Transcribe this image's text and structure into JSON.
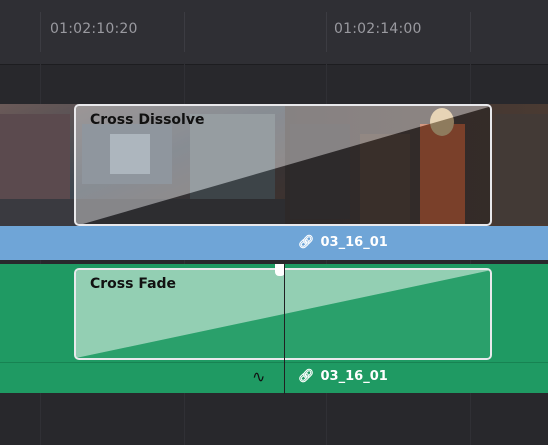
{
  "timeline": {
    "timecodes": [
      "01:02:10:20",
      "01:02:14:00"
    ]
  },
  "video_track": {
    "transition_label": "Cross Dissolve",
    "clip_name": "03_16_01",
    "link_icon": "link-icon"
  },
  "audio_track": {
    "transition_label": "Cross Fade",
    "clip_name": "03_16_01",
    "link_icon": "link-icon",
    "curve_icon": "fade-curve-icon"
  },
  "colors": {
    "video_bar": "#6fa5d7",
    "audio_track": "#1f9a63",
    "background": "#28282c"
  }
}
